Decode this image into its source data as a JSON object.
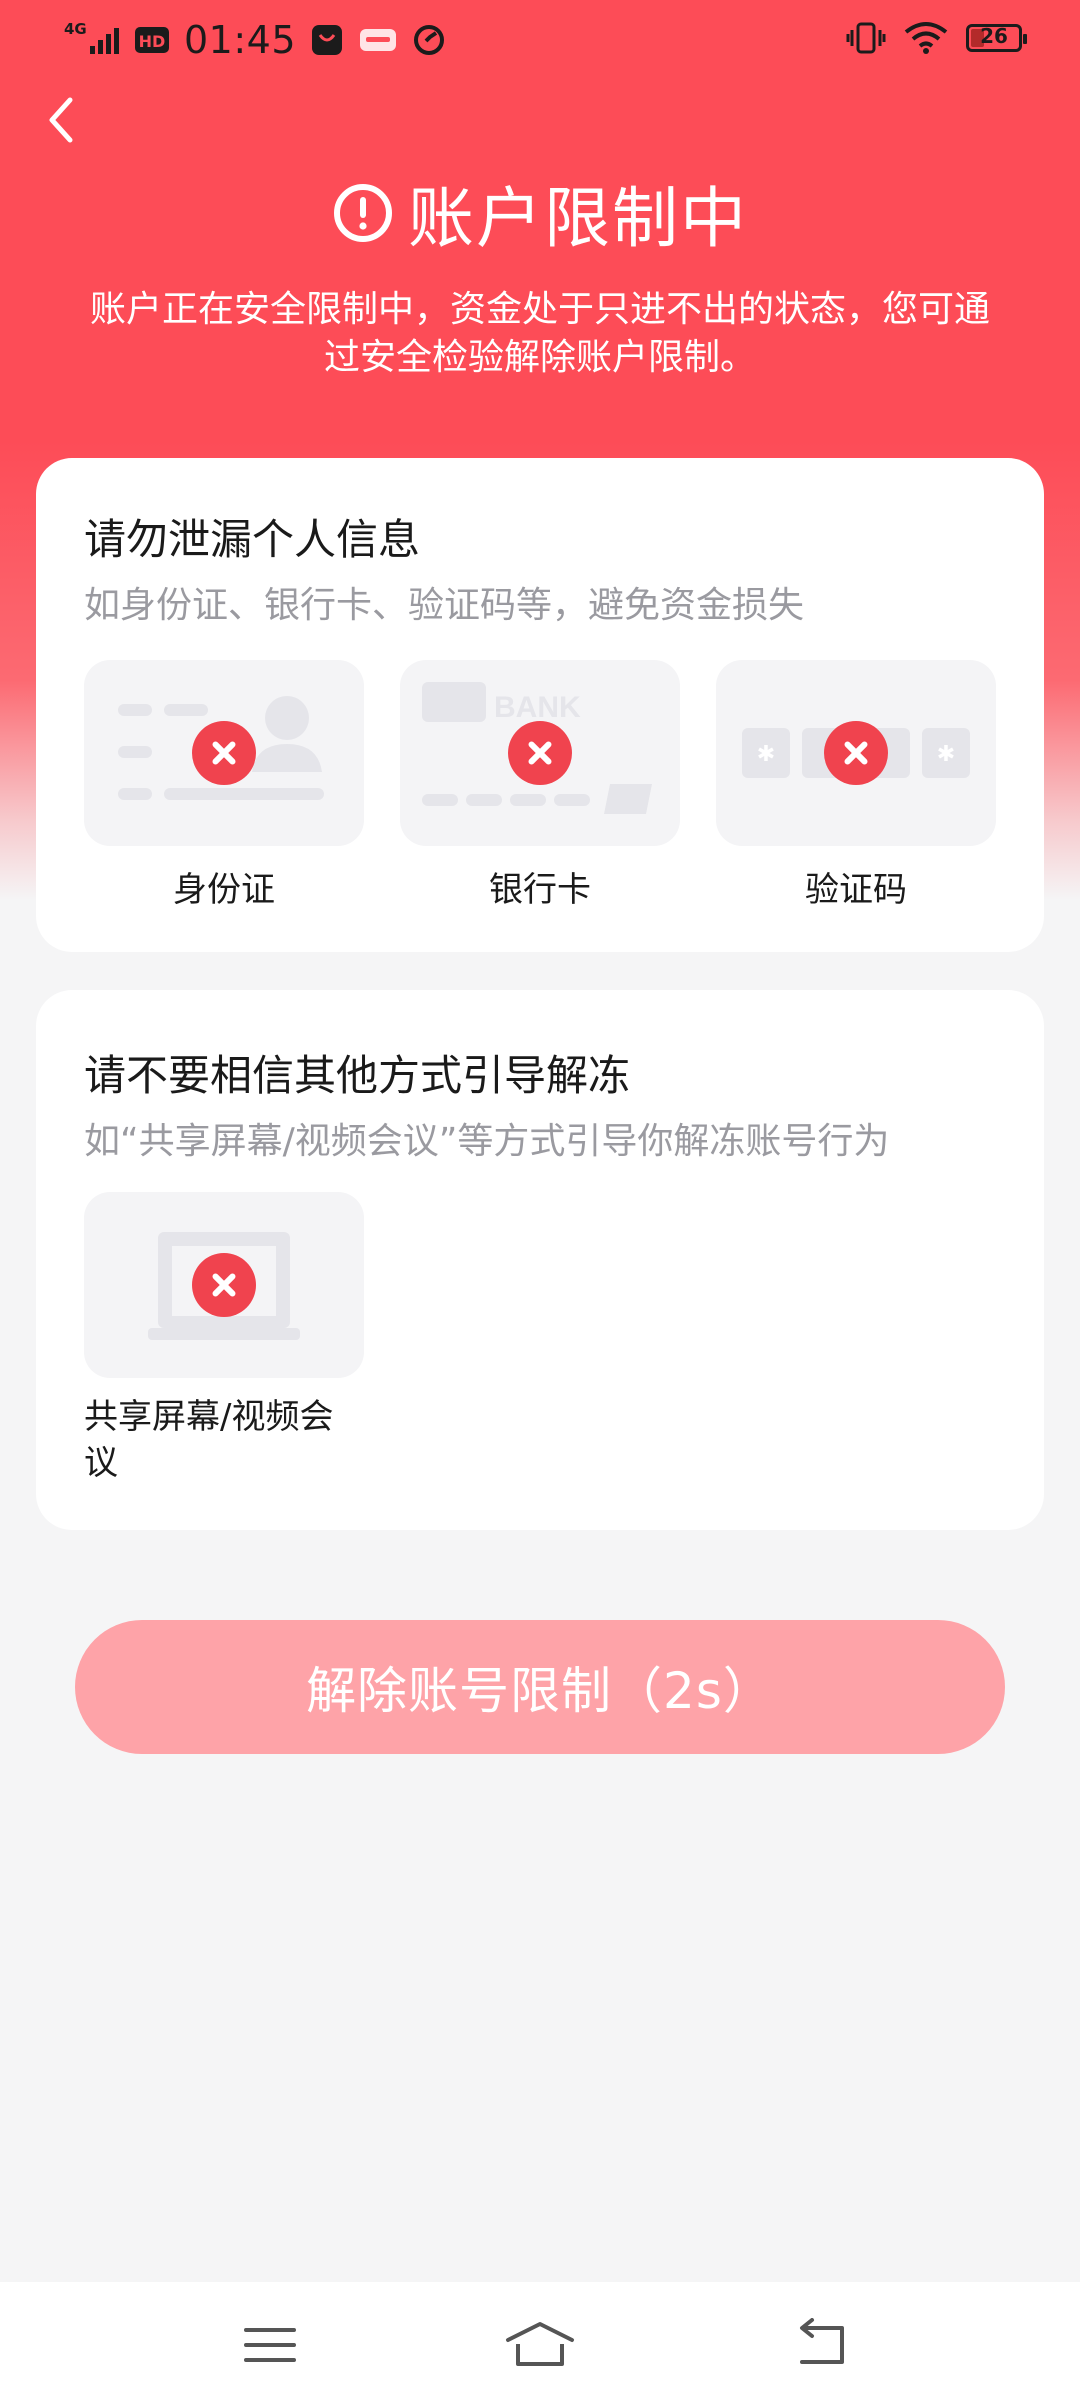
{
  "status_bar": {
    "network": "4G",
    "hd": "HD",
    "time": "01:45",
    "battery": "26"
  },
  "header": {
    "title": "账户限制中",
    "subtitle": "账户正在安全限制中，资金处于只进不出的状态，您可通过安全检验解除账户限制。"
  },
  "card_personal": {
    "title": "请勿泄漏个人信息",
    "description": "如身份证、银行卡、验证码等，避免资金损失",
    "items": [
      {
        "label": "身份证"
      },
      {
        "label": "银行卡",
        "art_text": "BANK"
      },
      {
        "label": "验证码"
      }
    ]
  },
  "card_unfreeze": {
    "title": "请不要相信其他方式引导解冻",
    "description": "如“共享屏幕/视频会议”等方式引导你解冻账号行为",
    "items": [
      {
        "label": "共享屏幕/视频会议"
      }
    ]
  },
  "action": {
    "button_label": "解除账号限制（2s）"
  },
  "colors": {
    "brand_red": "#fd4c57",
    "button_disabled": "#fea3a8",
    "error_red": "#f0434e"
  }
}
